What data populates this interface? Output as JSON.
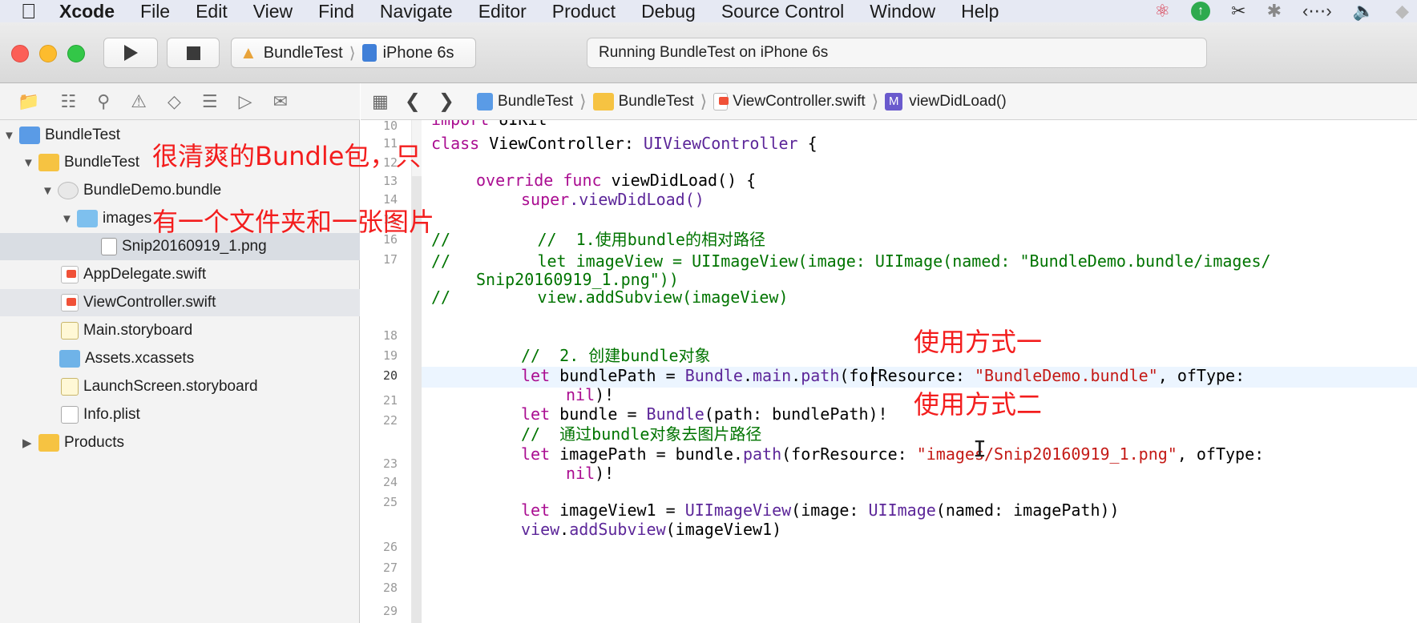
{
  "menubar": {
    "items": [
      "Xcode",
      "File",
      "Edit",
      "View",
      "Find",
      "Navigate",
      "Editor",
      "Product",
      "Debug",
      "Source Control",
      "Window",
      "Help"
    ]
  },
  "toolbar": {
    "scheme": "BundleTest",
    "device": "iPhone 6s",
    "activity": "Running BundleTest on iPhone 6s"
  },
  "navigator": {
    "items": [
      {
        "label": "BundleTest",
        "depth": 0,
        "icon": "project-icon",
        "disclosure": "open"
      },
      {
        "label": "BundleTest",
        "depth": 1,
        "icon": "folder-icon",
        "disclosure": "open"
      },
      {
        "label": "BundleDemo.bundle",
        "depth": 2,
        "icon": "bundle-icon",
        "disclosure": "open"
      },
      {
        "label": "images",
        "depth": 3,
        "icon": "blue-folder-icon",
        "disclosure": "open"
      },
      {
        "label": "Snip20160919_1.png",
        "depth": 4,
        "icon": "png-file-icon",
        "disclosure": "none"
      },
      {
        "label": "AppDelegate.swift",
        "depth": 2,
        "icon": "swift-file-icon",
        "disclosure": "none"
      },
      {
        "label": "ViewController.swift",
        "depth": 2,
        "icon": "swift-file-icon",
        "disclosure": "none"
      },
      {
        "label": "Main.storyboard",
        "depth": 2,
        "icon": "storyboard-icon",
        "disclosure": "none"
      },
      {
        "label": "Assets.xcassets",
        "depth": 2,
        "icon": "assets-icon",
        "disclosure": "none"
      },
      {
        "label": "LaunchScreen.storyboard",
        "depth": 2,
        "icon": "storyboard-icon",
        "disclosure": "none"
      },
      {
        "label": "Info.plist",
        "depth": 2,
        "icon": "plist-icon",
        "disclosure": "none"
      },
      {
        "label": "Products",
        "depth": 1,
        "icon": "folder-icon",
        "disclosure": "closed"
      }
    ]
  },
  "jumpbar": {
    "crumbs": [
      "BundleTest",
      "BundleTest",
      "ViewController.swift",
      "viewDidLoad()"
    ],
    "method_badge": "M"
  },
  "editor": {
    "line_numbers": [
      "10",
      "11",
      "12",
      "13",
      "14",
      "15",
      "16",
      "17",
      "18",
      "19",
      "20",
      "21",
      "22",
      "23",
      "24",
      "25",
      "26",
      "27",
      "28",
      "29"
    ],
    "code": {
      "l9_import": "import",
      "l9_mod": "UIKit",
      "l11_class": "class",
      "l11_name": " ViewController: ",
      "l11_super": "UIViewController",
      "l11_brace": " {",
      "l13_override": "override",
      "l13_func": "func",
      "l13_rest": " viewDidLoad() {",
      "l14_super": "super",
      "l14_rest": ".viewDidLoad()",
      "l16": "//         //  1.使用bundle的相对路径",
      "l17a": "//         let imageView = UIImageView(image: UIImage(named: \"BundleDemo.bundle/images/",
      "l17b": "Snip20160919_1.png\"))",
      "l18": "//         view.addSubview(imageView)",
      "l21": "//  2. 创建bundle对象",
      "l22_let": "let",
      "l22_a": " bundlePath = ",
      "l22_bundle": "Bundle",
      "l22_dot1": ".",
      "l22_main": "main",
      "l22_dot2": ".",
      "l22_path": "path",
      "l22_b": "(forResource: ",
      "l22_str": "\"BundleDemo.bundle\"",
      "l22_c": ", ofType:",
      "l22_nil": "nil",
      "l22_d": ")!",
      "l23_let": "let",
      "l23_a": " bundle = ",
      "l23_bundle": "Bundle",
      "l23_b": "(path: bundlePath)!",
      "l24": "//  通过bundle对象去图片路径",
      "l25_let": "let",
      "l25_a": " imagePath = bundle.",
      "l25_path": "path",
      "l25_b": "(forResource: ",
      "l25_str": "\"images/Snip20160919_1.png\"",
      "l25_c": ", ofType:",
      "l25_nil": "nil",
      "l25_d": ")!",
      "l27_let": "let",
      "l27_a": " imageView1 = ",
      "l27_uiiv": "UIImageView",
      "l27_b": "(image: ",
      "l27_uii": "UIImage",
      "l27_c": "(named: imagePath))",
      "l28_view": "view",
      "l28_dot": ".",
      "l28_add": "addSubview",
      "l28_rest": "(imageView1)"
    }
  },
  "annotations": {
    "a1": "很清爽的Bundle包，只",
    "a2": "有一个文件夹和一张图片",
    "a3": "使用方式一",
    "a4": "使用方式二"
  },
  "colors": {
    "annotation": "#f31d1d",
    "keyword": "#aa0d91",
    "comment": "#007400",
    "string": "#c41a16"
  }
}
